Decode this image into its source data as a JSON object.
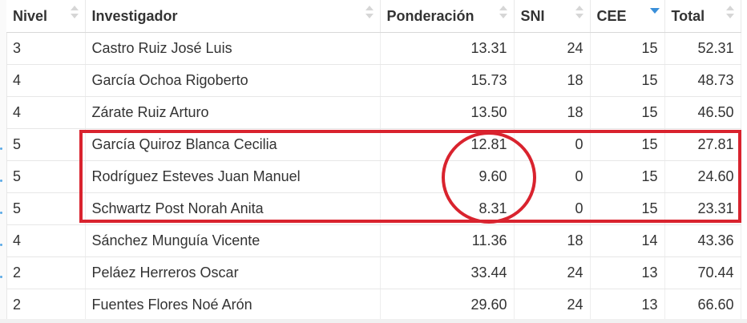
{
  "table": {
    "columns": [
      {
        "key": "nivel",
        "label": "Nivel",
        "align": "left",
        "sort": "none"
      },
      {
        "key": "investigador",
        "label": "Investigador",
        "align": "left",
        "sort": "none"
      },
      {
        "key": "ponderacion",
        "label": "Ponderación",
        "align": "left",
        "sort": "none"
      },
      {
        "key": "sni",
        "label": "SNI",
        "align": "left",
        "sort": "none"
      },
      {
        "key": "cee",
        "label": "CEE",
        "align": "left",
        "sort": "descending"
      },
      {
        "key": "total",
        "label": "Total",
        "align": "left",
        "sort": "none"
      }
    ],
    "rows": [
      {
        "nivel": "3",
        "investigador": "Castro Ruiz José Luis",
        "ponderacion": "13.31",
        "sni": "24",
        "cee": "15",
        "total": "52.31"
      },
      {
        "nivel": "4",
        "investigador": "García Ochoa Rigoberto",
        "ponderacion": "15.73",
        "sni": "18",
        "cee": "15",
        "total": "48.73"
      },
      {
        "nivel": "4",
        "investigador": "Zárate Ruiz Arturo",
        "ponderacion": "13.50",
        "sni": "18",
        "cee": "15",
        "total": "46.50"
      },
      {
        "nivel": "5",
        "investigador": "García Quiroz Blanca Cecilia",
        "ponderacion": "12.81",
        "sni": "0",
        "cee": "15",
        "total": "27.81"
      },
      {
        "nivel": "5",
        "investigador": "Rodríguez Esteves Juan Manuel",
        "ponderacion": "9.60",
        "sni": "0",
        "cee": "15",
        "total": "24.60"
      },
      {
        "nivel": "5",
        "investigador": "Schwartz Post Norah Anita",
        "ponderacion": "8.31",
        "sni": "0",
        "cee": "15",
        "total": "23.31"
      },
      {
        "nivel": "4",
        "investigador": "Sánchez Munguía Vicente",
        "ponderacion": "11.36",
        "sni": "18",
        "cee": "14",
        "total": "43.36"
      },
      {
        "nivel": "2",
        "investigador": "Peláez Herreros Oscar",
        "ponderacion": "33.44",
        "sni": "24",
        "cee": "13",
        "total": "70.44"
      },
      {
        "nivel": "2",
        "investigador": "Fuentes Flores Noé Arón",
        "ponderacion": "29.60",
        "sni": "24",
        "cee": "13",
        "total": "66.60"
      }
    ]
  },
  "colors": {
    "highlight": "#d9232e",
    "sort_active": "#3a8fd9",
    "sort_inactive": "#d6d6d6"
  }
}
